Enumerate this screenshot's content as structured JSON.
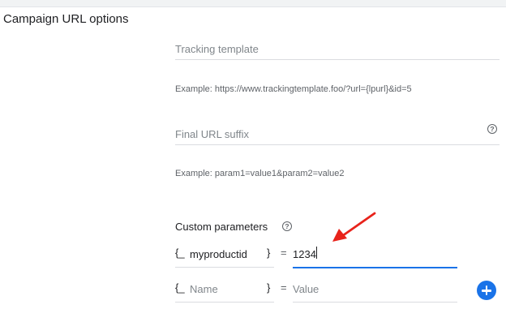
{
  "section": {
    "title": "Campaign URL options"
  },
  "tracking_template": {
    "placeholder": "Tracking template",
    "example": "Example: https://www.trackingtemplate.foo/?url={lpurl}&id=5"
  },
  "final_url_suffix": {
    "placeholder": "Final URL suffix",
    "example": "Example: param1=value1&param2=value2",
    "help_icon": "help-circle-icon"
  },
  "custom_parameters": {
    "label": "Custom parameters",
    "help_icon": "help-circle-icon",
    "rows": [
      {
        "brace_open": "{_",
        "key": "myproductid",
        "key_placeholder": "",
        "brace_close": "}",
        "equals": "=",
        "value": "1234",
        "value_placeholder": ""
      },
      {
        "brace_open": "{_",
        "key": "",
        "key_placeholder": "Name",
        "brace_close": "}",
        "equals": "=",
        "value": "",
        "value_placeholder": "Value"
      }
    ],
    "add_button_icon": "add-circle-icon"
  },
  "colors": {
    "accent": "#1a73e8",
    "annotation_arrow": "#e8231b"
  }
}
